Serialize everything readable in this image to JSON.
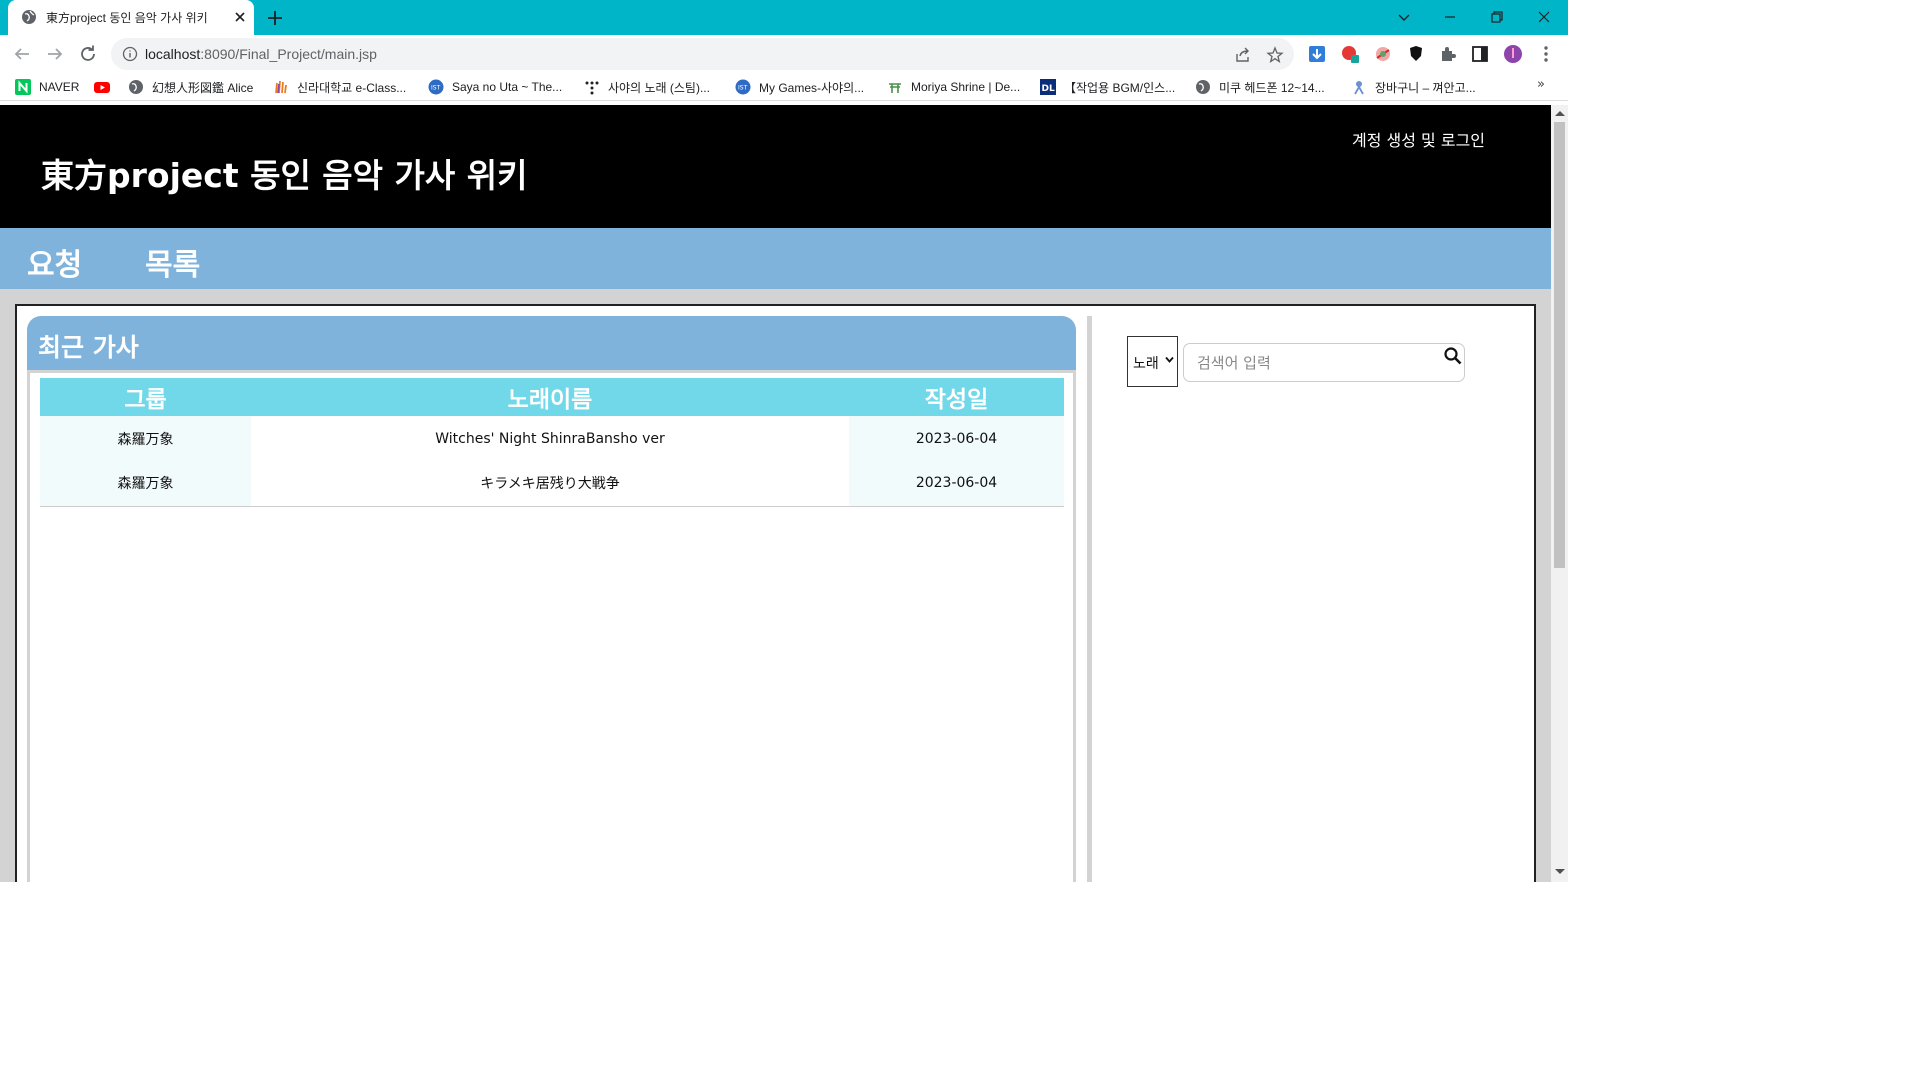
{
  "browser": {
    "tab_title": "東方project 동인 음악 가사 위키",
    "url_host": "localhost",
    "url_path": ":8090/Final_Project/main.jsp",
    "bookmarks": [
      {
        "label": "NAVER",
        "icon": "naver-icon"
      },
      {
        "label": "",
        "icon": "youtube-icon"
      },
      {
        "label": "幻想人形図鑑 Alice",
        "icon": "globe-icon"
      },
      {
        "label": "신라대학교 e-Class...",
        "icon": "hand-logo-icon"
      },
      {
        "label": "Saya no Uta ~ The...",
        "icon": "steam-icon"
      },
      {
        "label": "사야의 노래 (스팀)...",
        "icon": "dots-icon"
      },
      {
        "label": "My Games-사야의...",
        "icon": "steam-icon"
      },
      {
        "label": "Moriya Shrine | De...",
        "icon": "shrine-icon"
      },
      {
        "label": "【작업용 BGM/인스...",
        "icon": "dl-icon"
      },
      {
        "label": "미쿠 헤드폰 12~14...",
        "icon": "globe-icon"
      },
      {
        "label": "장바구니 – 껴안고...",
        "icon": "cart-icon"
      }
    ],
    "bookmarks_more": "»"
  },
  "site": {
    "title": "東方project 동인 음악 가사 위키",
    "login_label": "계정 생성 및 로그인",
    "nav": [
      {
        "label": "요청"
      },
      {
        "label": "목록"
      }
    ]
  },
  "recent": {
    "title": "최근 가사",
    "columns": [
      "그룹",
      "노래이름",
      "작성일"
    ],
    "rows": [
      {
        "group": "森羅万象",
        "song": "Witches' Night ShinraBansho ver",
        "date": "2023-06-04"
      },
      {
        "group": "森羅万象",
        "song": "キラメキ居残り大戦争",
        "date": "2023-06-04"
      }
    ]
  },
  "search": {
    "category_selected": "노래",
    "placeholder": "검색어 입력",
    "value": ""
  },
  "colors": {
    "browser_frame": "#00b5c8",
    "header_bg": "#000000",
    "nav_bg": "#80b3dc",
    "table_header_bg": "#70d8e8"
  }
}
